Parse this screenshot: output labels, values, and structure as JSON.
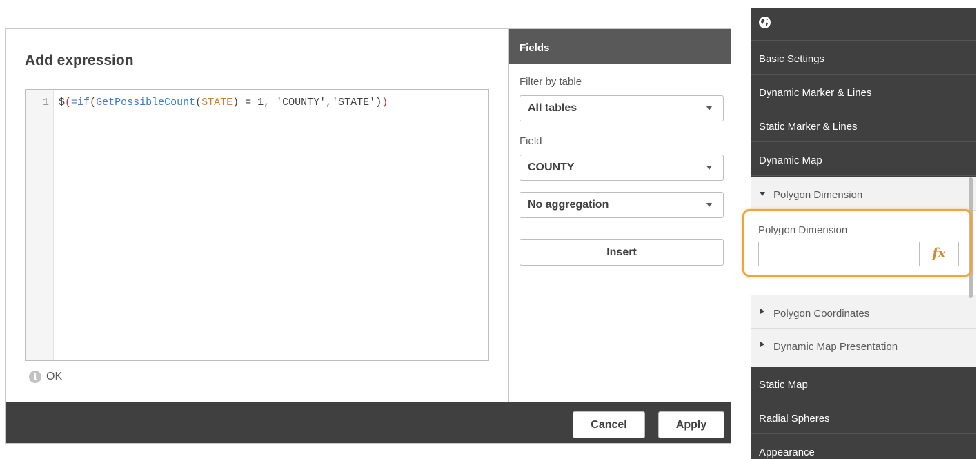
{
  "dialog": {
    "title": "Add expression",
    "editor": {
      "line_number": "1",
      "tokens": {
        "dollar": "$",
        "open_paren": "(",
        "eq_if": "=if",
        "paren2": "(",
        "fn": "GetPossibleCount",
        "paren3": "(",
        "field": "STATE",
        "paren4": ")",
        "rest": " = 1, 'COUNTY','STATE'",
        "close1": ")",
        "close2": ")"
      }
    },
    "status_text": "OK",
    "status_icon": "info-icon",
    "fields_panel": {
      "heading": "Fields",
      "filter_label": "Filter by table",
      "filter_value": "All tables",
      "field_label": "Field",
      "field_value": "COUNTY",
      "aggregation_value": "No aggregation",
      "insert_label": "Insert"
    },
    "footer": {
      "cancel_label": "Cancel",
      "apply_label": "Apply"
    }
  },
  "property_panel": {
    "header_icon": "globe-icon",
    "items_top": [
      "Basic Settings",
      "Dynamic Marker & Lines",
      "Static Marker & Lines",
      "Dynamic Map"
    ],
    "section_expanded": "Polygon Dimension",
    "polygon_dimension_label": "Polygon Dimension",
    "polygon_dimension_value": "",
    "fx_label": "fx",
    "sections_collapsed": [
      "Polygon Coordinates",
      "Dynamic Map Presentation"
    ],
    "items_bottom": [
      "Static Map",
      "Radial Spheres",
      "Appearance"
    ]
  },
  "colors": {
    "dark_header": "#404040",
    "fields_header": "#595959",
    "highlight": "#f0a538",
    "fx": "#d38a23",
    "code_keyword": "#3a7bd5",
    "code_field": "#c9803a",
    "code_paren": "#d0312d"
  }
}
